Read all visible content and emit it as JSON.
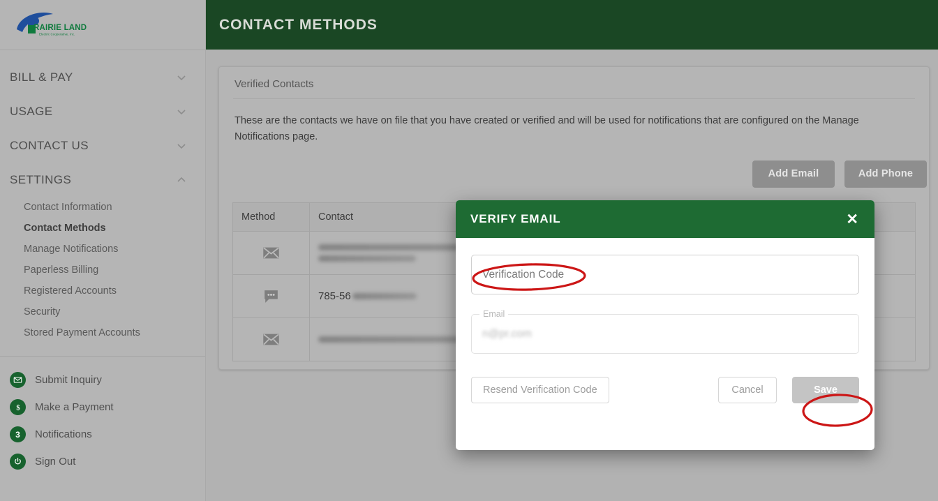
{
  "sidebar": {
    "logo": {
      "brand_line1": "PRAIRIE LAND",
      "brand_line2": "Electric Cooperative, Inc.",
      "swoosh_color": "#1f4e9c",
      "text_color": "#0f7a3d"
    },
    "groups": [
      {
        "label": "BILL & PAY",
        "icon": "chevron-down-icon",
        "expanded": false
      },
      {
        "label": "USAGE",
        "icon": "chevron-down-icon",
        "expanded": false
      },
      {
        "label": "CONTACT US",
        "icon": "chevron-down-icon",
        "expanded": false
      },
      {
        "label": "SETTINGS",
        "icon": "chevron-up-icon",
        "expanded": true
      }
    ],
    "settings_items": [
      {
        "label": "Contact Information",
        "active": false
      },
      {
        "label": "Contact Methods",
        "active": true
      },
      {
        "label": "Manage Notifications",
        "active": false
      },
      {
        "label": "Paperless Billing",
        "active": false
      },
      {
        "label": "Registered Accounts",
        "active": false
      },
      {
        "label": "Security",
        "active": false
      },
      {
        "label": "Stored Payment Accounts",
        "active": false
      }
    ],
    "bottom_items": [
      {
        "label": "Submit Inquiry",
        "icon": "envelope-icon"
      },
      {
        "label": "Make a Payment",
        "icon": "dollar-icon"
      },
      {
        "label": "Notifications",
        "icon": "badge-count-icon",
        "badge": "3"
      },
      {
        "label": "Sign Out",
        "icon": "power-icon"
      }
    ],
    "icon_color": "#17622e"
  },
  "header": {
    "title": "CONTACT METHODS",
    "background": "#1a4724",
    "text_color": "#d8dcd6"
  },
  "card": {
    "title": "Verified Contacts",
    "description": "These are the contacts we have on file that you have created or verified and will be used for notifications that are configured on the Manage Notifications page.",
    "add_email_label": "Add Email",
    "add_phone_label": "Add Phone"
  },
  "table": {
    "columns": [
      "Method",
      "Contact",
      ""
    ],
    "rows": [
      {
        "method_icon": "envelope-icon",
        "contact": "",
        "contact_redacted": true,
        "contact_lines": 2
      },
      {
        "method_icon": "chat-bubble-icon",
        "contact": "785-56",
        "contact_redacted": true,
        "contact_lines": 1
      },
      {
        "method_icon": "envelope-icon",
        "contact": "",
        "contact_redacted": true,
        "contact_lines": 1
      }
    ]
  },
  "modal": {
    "title": "VERIFY EMAIL",
    "close_icon": "close-icon",
    "header_background": "#1e6b33",
    "verification_field": {
      "placeholder": "Verification Code",
      "value": ""
    },
    "email_field": {
      "label": "Email",
      "value": "n@pr.com",
      "redacted": true,
      "disabled": true
    },
    "resend_label": "Resend Verification Code",
    "cancel_label": "Cancel",
    "save_label": "Save",
    "save_disabled": true
  },
  "annotations": {
    "color": "#cc1616",
    "marks": [
      {
        "target": "verification-code-input",
        "shape": "ellipse"
      },
      {
        "target": "save-button",
        "shape": "ellipse"
      }
    ]
  }
}
